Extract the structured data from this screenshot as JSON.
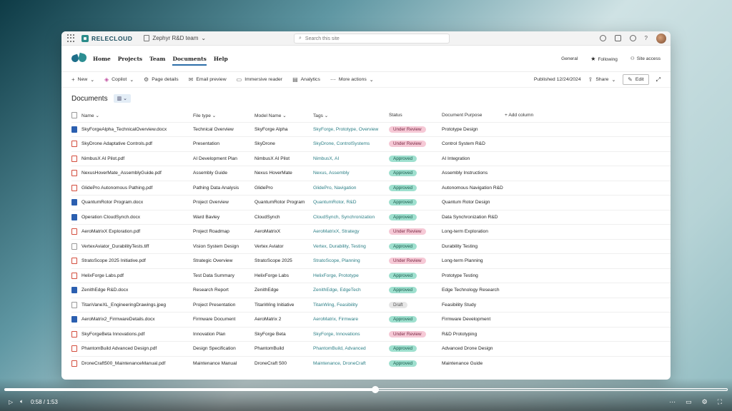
{
  "topbar": {
    "brand": "RELECLOUD",
    "team": "Zephyr R&D team",
    "search_placeholder": "Search this site"
  },
  "nav": {
    "links": [
      "Home",
      "Projects",
      "Team",
      "Documents",
      "Help"
    ],
    "active": "Documents",
    "general": "General",
    "following": "Following",
    "site_access": "Site access"
  },
  "commands": {
    "new": "New",
    "copilot": "Copilot",
    "page_details": "Page details",
    "email_preview": "Email preview",
    "immersive_reader": "Immersive reader",
    "analytics": "Analytics",
    "more_actions": "More actions",
    "published": "Published 12/24/2024",
    "share": "Share",
    "edit": "Edit"
  },
  "library": {
    "title": "Documents",
    "columns": [
      "Name",
      "File type",
      "Model Name",
      "Tags",
      "Status",
      "Document Purpose",
      "+ Add column"
    ],
    "rows": [
      {
        "name": "SkyForgeAlpha_TechnicalOverview.docx",
        "ext": "docx",
        "type": "Technical Overview",
        "model": "SkyForge Alpha",
        "tags": "SkyForge, Prototype, Overview",
        "status": "Under Review",
        "purpose": "Prototype Design"
      },
      {
        "name": "SkyDrone Adaptative Controls.pdf",
        "ext": "pdf",
        "type": "Presentation",
        "model": "SkyDrone",
        "tags": "SkyDrone, ControlSystems",
        "status": "Under Review",
        "purpose": "Control System R&D"
      },
      {
        "name": "NimbusX AI Pilot.pdf",
        "ext": "pdf",
        "type": "AI Development Plan",
        "model": "NimbusX AI Pilot",
        "tags": "NimbusX, AI",
        "status": "Approved",
        "purpose": "AI Integration"
      },
      {
        "name": "NexusHoverMate_AssemblyGuide.pdf",
        "ext": "pdf",
        "type": "Assembly Guide",
        "model": "Nexus HoverMate",
        "tags": "Nexus, Assembly",
        "status": "Approved",
        "purpose": "Assembly Instructions"
      },
      {
        "name": "GlidePro Autonomous Pathing.pdf",
        "ext": "pdf",
        "type": "Pathing Data Analysis",
        "model": "GlidePro",
        "tags": "GlidePro, Navigation",
        "status": "Approved",
        "purpose": "Autonomous Navigation R&D"
      },
      {
        "name": "QuantumRotor Program.docx",
        "ext": "docx",
        "type": "Project Overview",
        "model": "QuantumRotor Program",
        "tags": "QuantumRotor, R&D",
        "status": "Approved",
        "purpose": "Quantum Rotor Design"
      },
      {
        "name": "Operation CloudSynch.docx",
        "ext": "docx",
        "type": "Ward Bavley",
        "model": "CloudSynch",
        "tags": "CloudSynch, Synchronization",
        "status": "Approved",
        "purpose": "Data Synchronization R&D"
      },
      {
        "name": "AeroMatrixX Exploration.pdf",
        "ext": "pdf",
        "type": "Project Roadmap",
        "model": "AeroMatrixX",
        "tags": "AeroMatrixX, Strategy",
        "status": "Under Review",
        "purpose": "Long-term Exploration"
      },
      {
        "name": "VertexAviator_DurabilityTests.tiff",
        "ext": "img",
        "type": "Vision System Design",
        "model": "Vertex Aviator",
        "tags": "Vertex, Durability, Testing",
        "status": "Approved",
        "purpose": "Durability Testing"
      },
      {
        "name": "StratoScope 2025 Initiative.pdf",
        "ext": "pdf",
        "type": "Strategic Overview",
        "model": "StratoScope 2025",
        "tags": "StratoScope, Planning",
        "status": "Under Review",
        "purpose": "Long-term Planning"
      },
      {
        "name": "HelixForge Labs.pdf",
        "ext": "pdf",
        "type": "Test Data Summary",
        "model": "HelixForge Labs",
        "tags": "HelixForge, Prototype",
        "status": "Approved",
        "purpose": "Prototype Testing"
      },
      {
        "name": "ZenithEdge R&D.docx",
        "ext": "docx",
        "type": "Research Report",
        "model": "ZenithEdge",
        "tags": "ZenithEdge, EdgeTech",
        "status": "Approved",
        "purpose": "Edge Technology Research"
      },
      {
        "name": "TitanVaneXL_EngineeringDrawings.jpeg",
        "ext": "img",
        "type": "Project Presentation",
        "model": "TitanWing Initiative",
        "tags": "TitanWing, Feasibility",
        "status": "Draft",
        "purpose": "Feasibility Study"
      },
      {
        "name": "AeroMatrix2_FirmwareDetails.docx",
        "ext": "docx",
        "type": "Firmware Document",
        "model": "AeroMatrix 2",
        "tags": "AeroMatrix, Firmware",
        "status": "Approved",
        "purpose": "Firmware Development"
      },
      {
        "name": "SkyForgeBeta Innovations.pdf",
        "ext": "pdf",
        "type": "Innovation Plan",
        "model": "SkyForge Beta",
        "tags": "SkyForge, Innovations",
        "status": "Under Review",
        "purpose": "R&D Prototyping"
      },
      {
        "name": "PhantomBuild Advanced Design.pdf",
        "ext": "pdf",
        "type": "Design Specification",
        "model": "PhantomBuild",
        "tags": "PhantomBuild, Advanced",
        "status": "Approved",
        "purpose": "Advanced Drone Design"
      },
      {
        "name": "DroneCraft500_MaintenanceManual.pdf",
        "ext": "pdf",
        "type": "Maintenance Manual",
        "model": "DroneCraft 500",
        "tags": "Maintenance, DroneCraft",
        "status": "Approved",
        "purpose": "Maintenance Guide"
      }
    ]
  },
  "status_colors": {
    "Under Review": {
      "bg": "#f6c9d6",
      "fg": "#7a2a45"
    },
    "Approved": {
      "bg": "#9fe0cf",
      "fg": "#17594a"
    },
    "Draft": {
      "bg": "#e6e6e6",
      "fg": "#555555"
    }
  },
  "video": {
    "time": "0:58 / 1:53",
    "progress": 0.513
  }
}
